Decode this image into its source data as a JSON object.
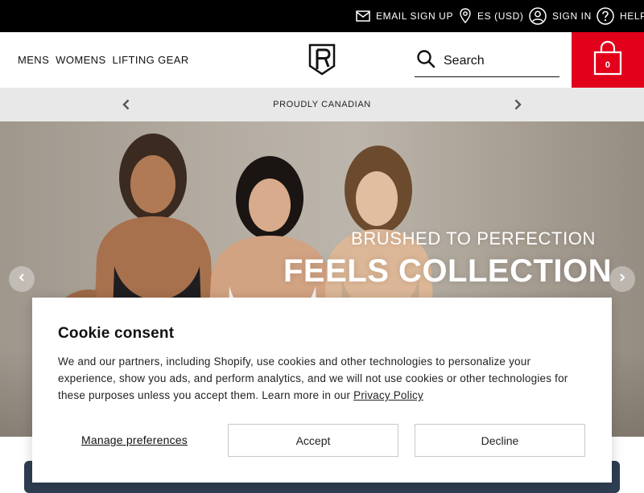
{
  "utility_bar": {
    "email_signup": "Email Sign Up",
    "locale": "ES (USD)",
    "sign_in": "Sign In",
    "help": "Help",
    "icons": {
      "email": "envelope-icon",
      "locale": "map-pin-icon",
      "sign_in": "user-circle-icon",
      "help": "question-circle-icon"
    }
  },
  "header": {
    "nav": [
      "Mens",
      "Womens",
      "Lifting Gear"
    ],
    "logo_icon": "brand-logo-icon",
    "search": {
      "placeholder": "Search",
      "icon": "search-icon"
    },
    "cart": {
      "count": "0",
      "icon": "shopping-bag-icon",
      "color": "#e3001b"
    }
  },
  "announcement": {
    "text": "Proudly Canadian",
    "icons": {
      "prev": "chevron-left-icon",
      "next": "chevron-right-icon"
    }
  },
  "hero": {
    "subtitle": "Brushed to perfection",
    "title": "Feels Collection",
    "icons": {
      "prev": "chevron-left-icon",
      "next": "chevron-right-icon"
    }
  },
  "cookie": {
    "title": "Cookie consent",
    "body": "We and our partners, including Shopify, use cookies and other technologies to personalize your experience, show you ads, and perform analytics, and we will not use cookies or other technologies for these purposes unless you accept them. Learn more in our",
    "link": "Privacy Policy",
    "manage": "Manage preferences",
    "accept": "Accept",
    "decline": "Decline"
  }
}
